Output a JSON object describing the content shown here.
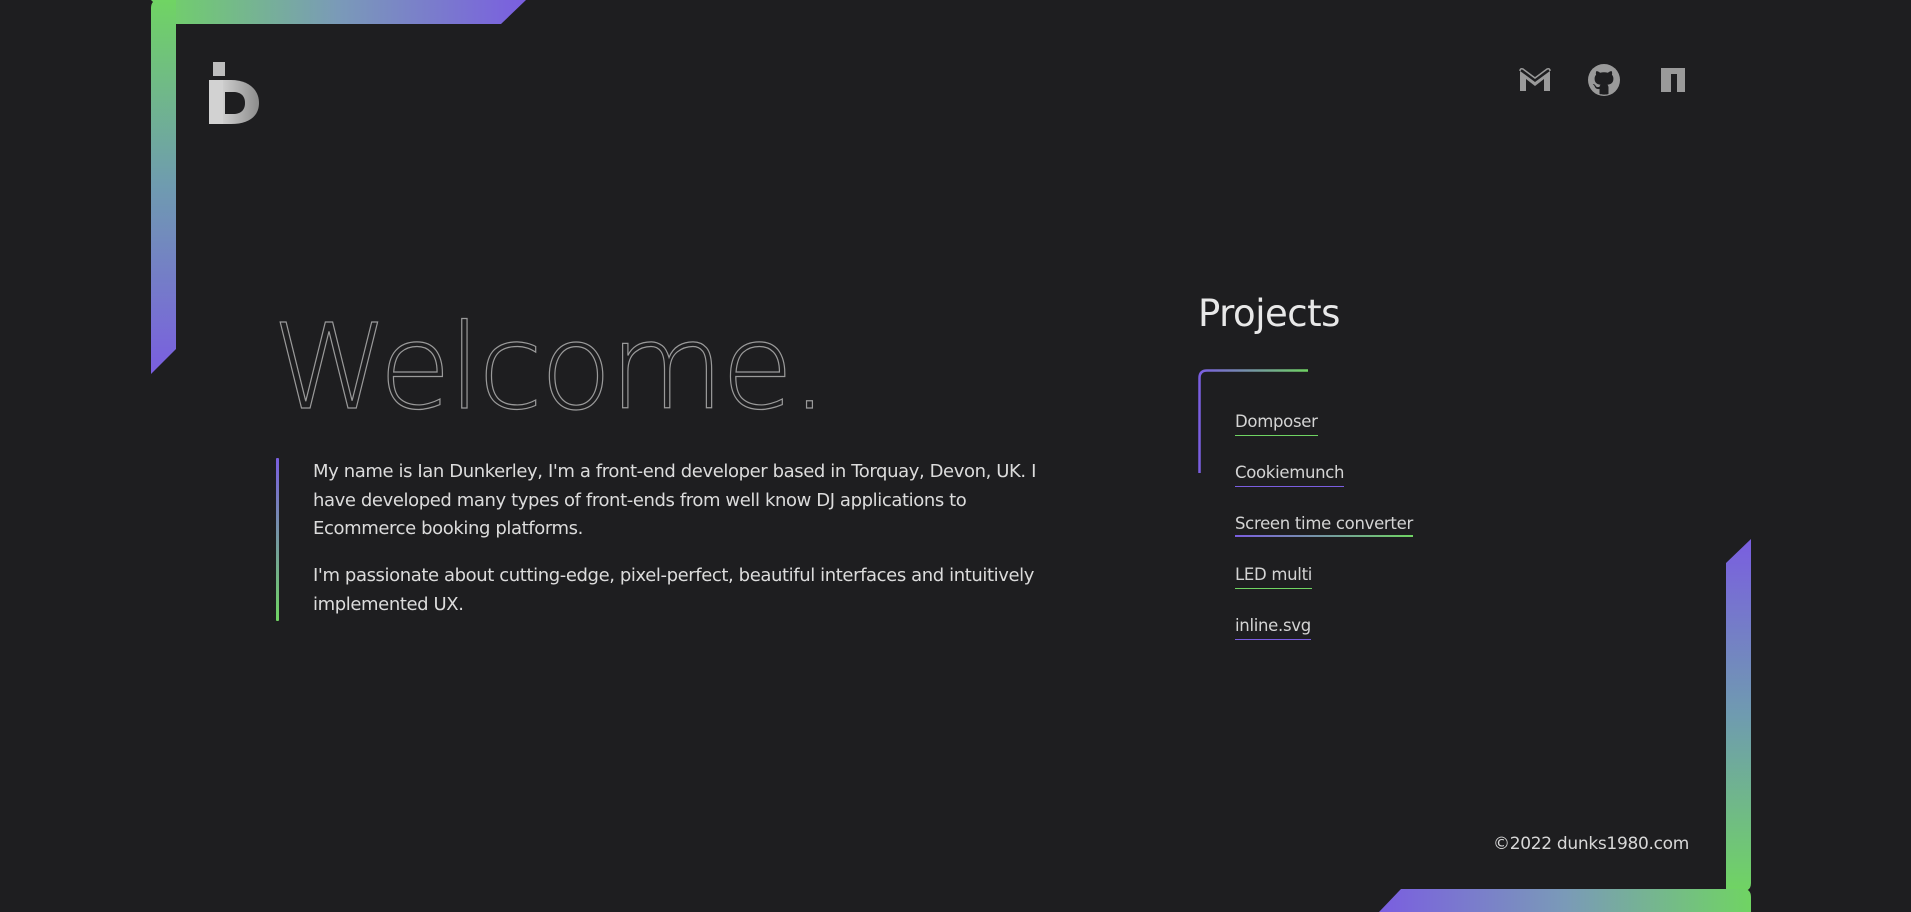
{
  "colors": {
    "background": "#1e1e20",
    "accent_purple": "#7a5ee0",
    "accent_green": "#70d463",
    "icon_gray": "#9a9a9a"
  },
  "header": {
    "logo_icon": "id-monogram-logo",
    "social": [
      {
        "name": "email",
        "icon": "gmail-icon"
      },
      {
        "name": "github",
        "icon": "github-icon"
      },
      {
        "name": "npm",
        "icon": "npm-icon"
      }
    ]
  },
  "hero": {
    "title": "Welcome.",
    "paragraphs": [
      "My name is Ian Dunkerley, I'm a front-end developer based in Torquay, Devon, UK. I have developed many types of front-ends from well know DJ applications to Ecommerce booking platforms.",
      "I'm passionate about cutting-edge, pixel-perfect, beautiful interfaces and intuitively implemented UX."
    ]
  },
  "projects": {
    "title": "Projects",
    "items": [
      {
        "label": "Domposer"
      },
      {
        "label": "Cookiemunch"
      },
      {
        "label": "Screen time converter"
      },
      {
        "label": "LED multi"
      },
      {
        "label": "inline.svg"
      }
    ]
  },
  "footer": {
    "copyright": "©2022 dunks1980.com"
  }
}
